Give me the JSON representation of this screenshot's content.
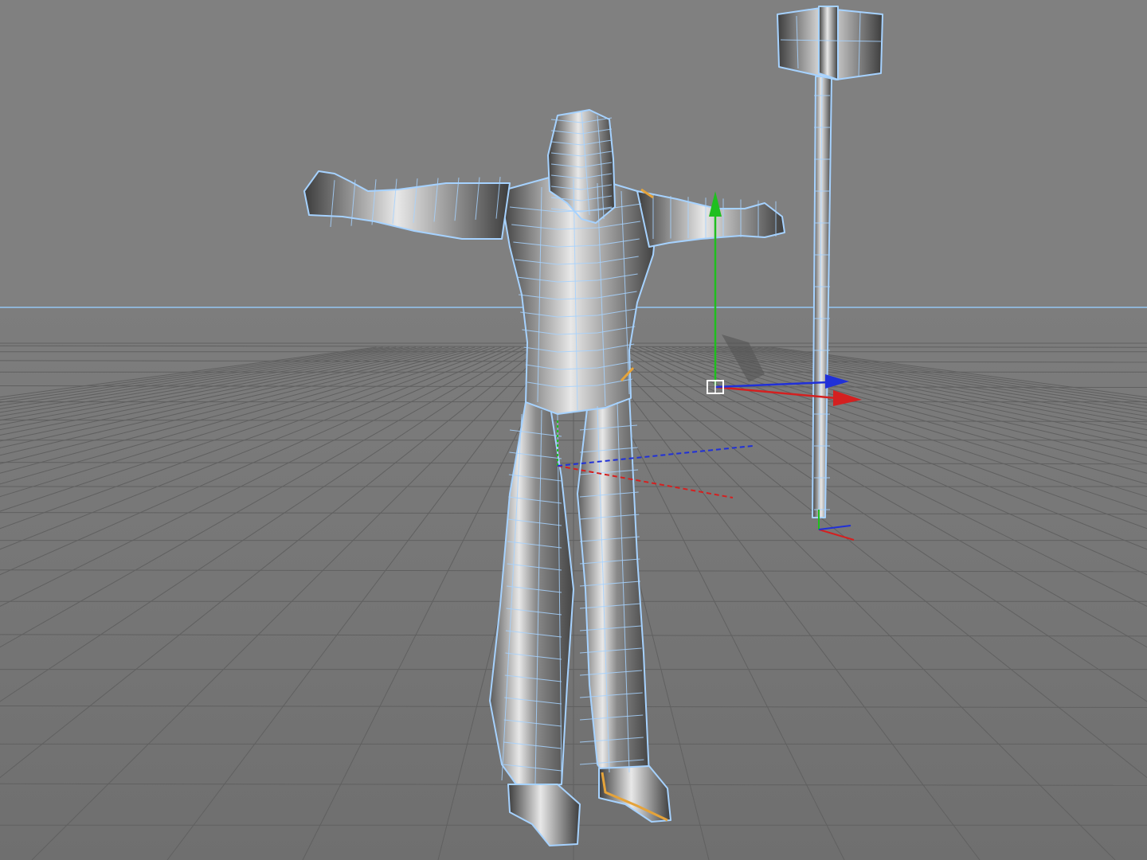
{
  "viewport": {
    "view": "perspective",
    "background_color": "#808080",
    "grid_color": "#606060",
    "horizon_line_color": "#8fb4d6",
    "wireframe_color": "#a6d2ff",
    "mesh_shade_dark": "#3c3c3c",
    "mesh_shade_light": "#e8e8e8",
    "selection_accent_color": "#e5a33a",
    "axis_colors": {
      "x": "#d42020",
      "y": "#1fbf1f",
      "z": "#2030d8"
    }
  },
  "scene": {
    "objects": [
      {
        "kind": "character-mesh",
        "display": "shaded-wireframe"
      },
      {
        "kind": "hammer-mesh",
        "display": "shaded-wireframe"
      }
    ],
    "active_manipulator": "move-tool"
  }
}
